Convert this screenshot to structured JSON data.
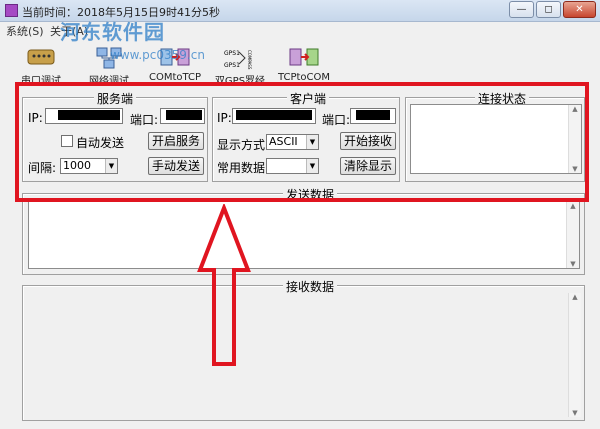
{
  "window": {
    "title": "当前时间：2018年5月15日9时41分5秒",
    "controls": [
      "—",
      "◻",
      "✕"
    ]
  },
  "menu": [
    "系统(S)",
    "关于(A)"
  ],
  "watermark": {
    "logo": "河东软件园",
    "url": "www.pc0359.cn"
  },
  "toolbar": {
    "items": [
      {
        "label": "串口调试",
        "icon": "serial-port-icon"
      },
      {
        "label": "网络调试",
        "icon": "network-icon"
      },
      {
        "label": "COMtoTCP",
        "icon": "com-to-tcp-icon"
      },
      {
        "label": "双GPS罗经",
        "icon": "gps-compass-icon",
        "icon_text": [
          "GPS1",
          "GPS1",
          "COMPASS"
        ]
      },
      {
        "label": "TCPtoCOM",
        "icon": "tcp-to-com-icon"
      }
    ]
  },
  "server": {
    "title": "服务端",
    "ip_label": "IP:",
    "port_label": "端口:",
    "autosend_label": "自动发送",
    "autosend_checked": false,
    "start_button": "开启服务",
    "interval_label": "间隔:",
    "interval_value": "1000",
    "manual_send_button": "手动发送"
  },
  "client": {
    "title": "客户端",
    "ip_label": "IP:",
    "port_label": "端口:",
    "display_mode_label": "显示方式:",
    "display_mode_value": "ASCII",
    "start_receive_button": "开始接收",
    "common_data_label": "常用数据:",
    "common_data_value": "",
    "clear_button": "清除显示"
  },
  "status": {
    "title": "连接状态"
  },
  "send": {
    "title": "发送数据"
  },
  "receive": {
    "title": "接收数据"
  },
  "colors": {
    "annotation_red": "#e01520",
    "window_bg": "#f0f0f0",
    "watermark_blue": "#2f7fc8"
  }
}
